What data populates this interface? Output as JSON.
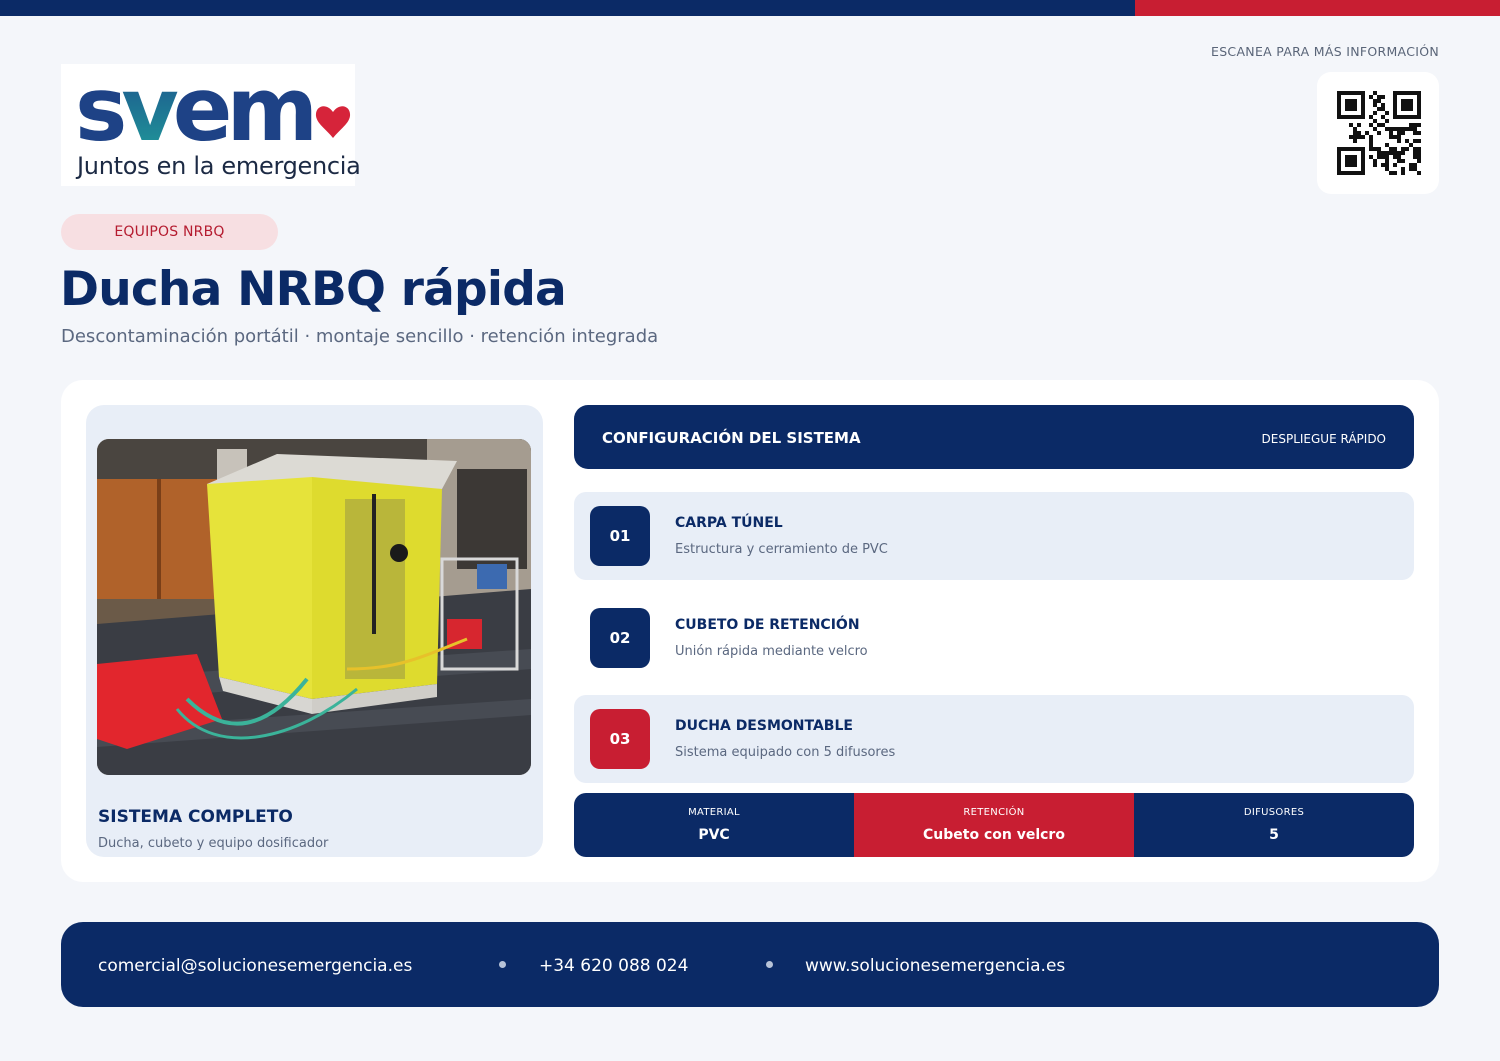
{
  "colors": {
    "navy": "#0b2a66",
    "red": "#c81e32",
    "background": "#f4f6fa",
    "panel": "#e8eef7"
  },
  "brand": {
    "logo_word": "svem",
    "tagline": "Juntos en la emergencia"
  },
  "qr": {
    "label": "ESCANEA PARA MÁS INFORMACIÓN",
    "icon": "qr-code"
  },
  "category": "EQUIPOS NRBQ",
  "title": "Ducha NRBQ rápida",
  "subtitle": "Descontaminación portátil · montaje sencillo · retención integrada",
  "photo": {
    "title": "SISTEMA COMPLETO",
    "caption": "Ducha, cubeto y equipo dosificador"
  },
  "config": {
    "title": "CONFIGURACIÓN DEL SISTEMA",
    "badge": "DESPLIEGUE RÁPIDO",
    "steps": [
      {
        "num": "01",
        "title": "CARPA TÚNEL",
        "desc": "Estructura y cerramiento de PVC"
      },
      {
        "num": "02",
        "title": "CUBETO DE RETENCIÓN",
        "desc": "Unión rápida mediante velcro"
      },
      {
        "num": "03",
        "title": "DUCHA DESMONTABLE",
        "desc": "Sistema equipado con 5 difusores"
      }
    ]
  },
  "specs": [
    {
      "label": "MATERIAL",
      "value": "PVC"
    },
    {
      "label": "RETENCIÓN",
      "value": "Cubeto con velcro"
    },
    {
      "label": "DIFUSORES",
      "value": "5"
    }
  ],
  "footer": {
    "email": "comercial@solucionesemergencia.es",
    "phone": "+34 620 088 024",
    "web": "www.solucionesemergencia.es"
  }
}
